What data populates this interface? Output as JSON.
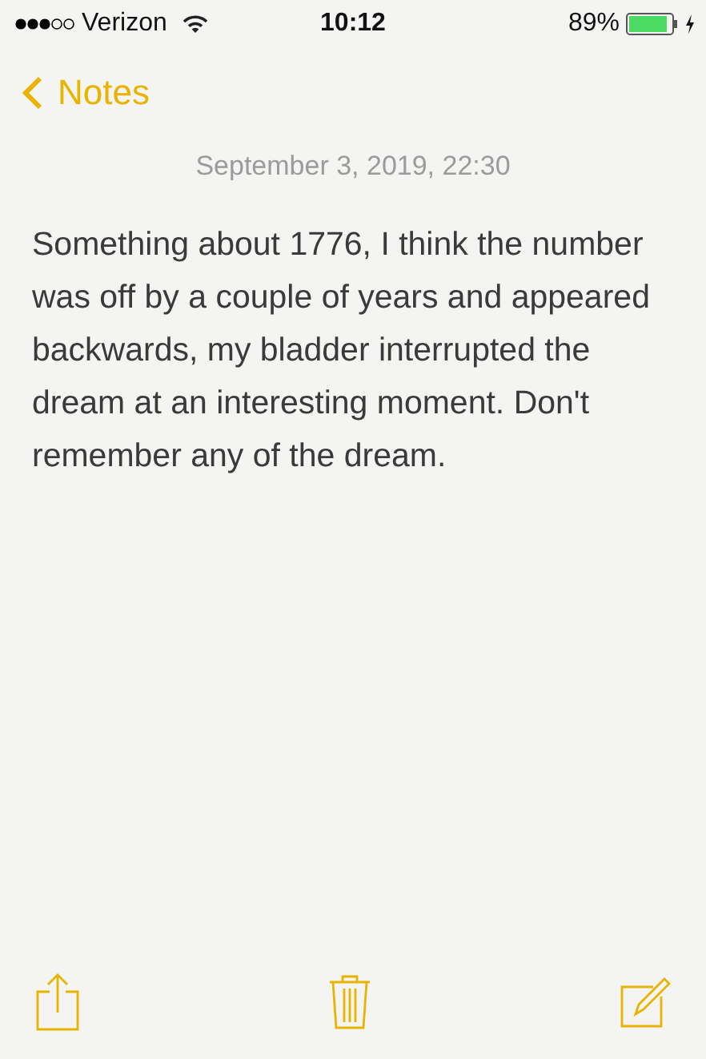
{
  "status_bar": {
    "carrier": "Verizon",
    "time": "10:12",
    "battery": "89%"
  },
  "nav": {
    "back_label": "Notes"
  },
  "note": {
    "date": "September 3, 2019, 22:30",
    "body": "Something about 1776, I think the number was off by a couple of years and appeared backwards, my bladder interrupted the dream at an interesting moment. Don't remember any of the dream."
  }
}
